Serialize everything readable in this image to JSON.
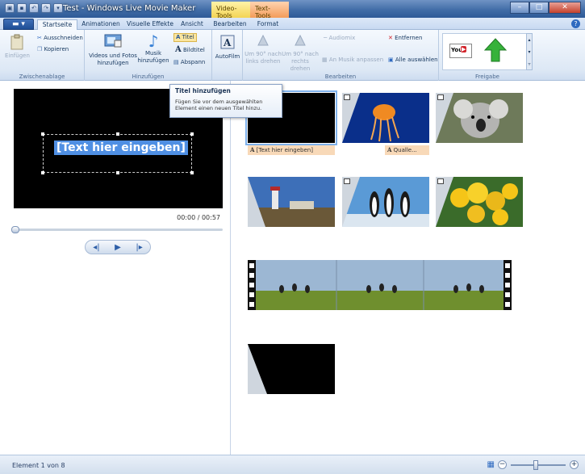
{
  "window": {
    "title": "Test - Windows Live Movie Maker",
    "context_tabs": [
      "Video-Tools",
      "Text-Tools"
    ]
  },
  "tabs": [
    "Startseite",
    "Animationen",
    "Visuelle Effekte",
    "Ansicht",
    "Bearbeiten",
    "Format"
  ],
  "active_tab": "Startseite",
  "ribbon": {
    "clipboard": {
      "paste": "Einfügen",
      "cut": "Ausschneiden",
      "copy": "Kopieren",
      "label": "Zwischenablage"
    },
    "add": {
      "videos_photos": "Videos und Fotos hinzufügen",
      "music": "Musik hinzufügen",
      "title": "Titel",
      "caption": "Bildtitel",
      "credits": "Abspann",
      "label": "Hinzufügen"
    },
    "autofilm": "AutoFilm",
    "edit": {
      "rotate_left": "Um 90° nach links drehen",
      "rotate_right": "Um 90° nach rechts drehen",
      "audiomix": "Audiomix",
      "fit_music": "An Musik anpassen",
      "remove": "Entfernen",
      "select_all": "Alle auswählen",
      "label": "Bearbeiten"
    },
    "share": {
      "youtube": "YouTube",
      "label": "Freigabe"
    }
  },
  "tooltip": {
    "title": "Titel hinzufügen",
    "body": "Fügen Sie vor dem ausgewählten Element einen neuen Titel hinzu."
  },
  "preview": {
    "text": "[Text hier eingeben]",
    "timecode": "00:00 / 00:57"
  },
  "storyboard": {
    "label_title": "[Text hier eingeben]",
    "label_quallen": "Qualle..."
  },
  "status": {
    "text": "Element 1 von 8"
  },
  "colors": {
    "accent": "#2f6ac0",
    "title_bar": "#3e6aa5",
    "label_bg": "#f8d9b8"
  }
}
